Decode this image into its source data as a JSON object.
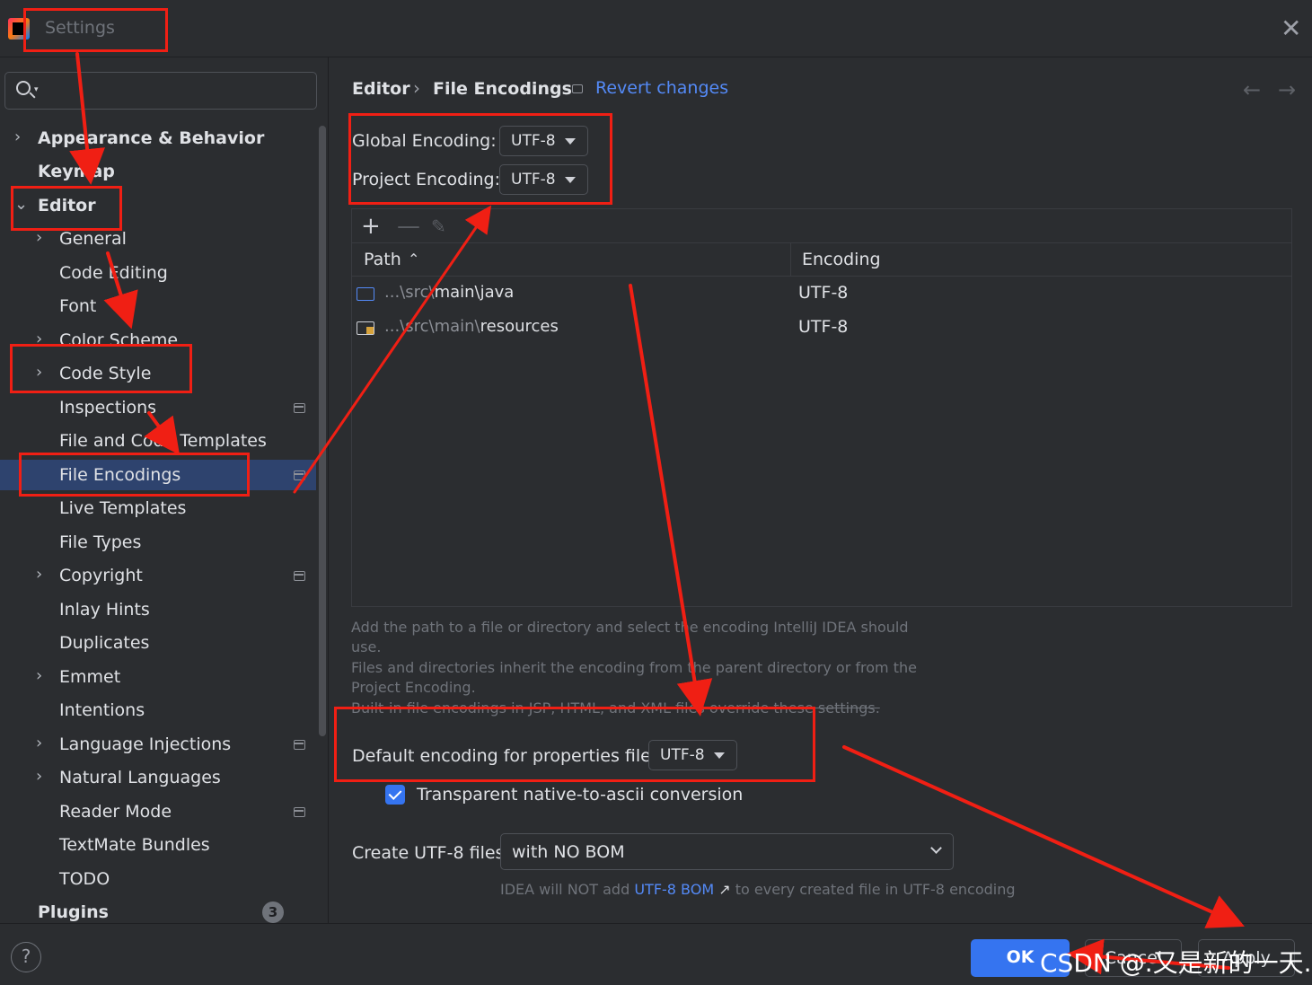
{
  "window": {
    "title": "Settings",
    "close_glyph": "✕"
  },
  "sidebar": {
    "search_placeholder": "",
    "items": [
      {
        "label": "Appearance & Behavior",
        "chevron": "›"
      },
      {
        "label": "Keymap"
      },
      {
        "label": "Editor",
        "chevron": "⌄"
      },
      {
        "label": "General",
        "chevron": "›"
      },
      {
        "label": "Code Editing"
      },
      {
        "label": "Font"
      },
      {
        "label": "Color Scheme",
        "chevron": "›"
      },
      {
        "label": "Code Style",
        "chevron": "›"
      },
      {
        "label": "Inspections"
      },
      {
        "label": "File and Code Templates"
      },
      {
        "label": "File Encodings"
      },
      {
        "label": "Live Templates"
      },
      {
        "label": "File Types"
      },
      {
        "label": "Copyright",
        "chevron": "›"
      },
      {
        "label": "Inlay Hints"
      },
      {
        "label": "Duplicates"
      },
      {
        "label": "Emmet",
        "chevron": "›"
      },
      {
        "label": "Intentions"
      },
      {
        "label": "Language Injections",
        "chevron": "›"
      },
      {
        "label": "Natural Languages",
        "chevron": "›"
      },
      {
        "label": "Reader Mode"
      },
      {
        "label": "TextMate Bundles"
      },
      {
        "label": "TODO"
      },
      {
        "label": "Plugins",
        "badge": "3"
      }
    ]
  },
  "breadcrumb": {
    "parent": "Editor",
    "separator": "›",
    "current": "File Encodings",
    "revert": "Revert changes",
    "back": "←",
    "forward": "→"
  },
  "encodings": {
    "global_label": "Global Encoding:",
    "global_value": "UTF-8",
    "project_label": "Project Encoding:",
    "project_value": "UTF-8"
  },
  "table": {
    "toolbar": {
      "add": "+",
      "remove": "—",
      "edit": "✎"
    },
    "columns": {
      "path": "Path",
      "sort": "⌃",
      "encoding": "Encoding"
    },
    "rows": [
      {
        "path_dim": "...\\src\\",
        "path_bright": "main\\java",
        "encoding": "UTF-8"
      },
      {
        "path_dim": "...\\src\\main\\",
        "path_bright": "resources",
        "encoding": "UTF-8"
      }
    ]
  },
  "hints": {
    "line1": "Add the path to a file or directory and select the encoding IntelliJ IDEA should",
    "line2": "use.",
    "line3": "Files and directories inherit the encoding from the parent directory or from the",
    "line4": "Project Encoding.",
    "line5": "Built-in file encodings in JSP, HTML, and XML files override these settings."
  },
  "properties": {
    "label": "Default encoding for properties files:",
    "value": "UTF-8"
  },
  "transparent": {
    "label": "Transparent native-to-ascii conversion",
    "checked": true
  },
  "bom": {
    "label": "Create UTF-8 files:",
    "value": "with NO BOM",
    "hint_pre": "IDEA will NOT add",
    "hint_link": "UTF-8 BOM",
    "hint_arrow": "↗",
    "hint_post": "to every created file in UTF-8 encoding"
  },
  "footer": {
    "help": "?",
    "ok": "OK",
    "cancel": "Cancel",
    "apply": "Apply"
  },
  "watermark": "CSDN @.又是新的一天.",
  "colors": {
    "accent": "#3574f0",
    "link": "#548af7",
    "annotation": "#f01f14",
    "selection": "#2e436e"
  }
}
